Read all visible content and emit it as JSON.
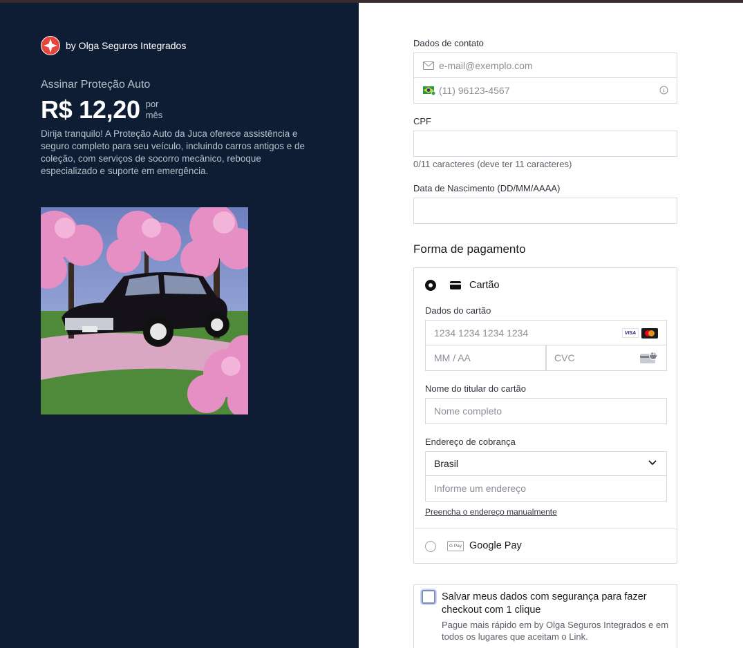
{
  "merchant": {
    "name": "by Olga Seguros Integrados"
  },
  "product": {
    "title": "Assinar Proteção Auto",
    "price": "R$ 12,20",
    "per_1": "por",
    "per_2": "mês",
    "description": "Dirija tranquilo! A Proteção Auto da Juca oferece assistência e seguro completo para seu veículo, incluindo carros antigos e de coleção, com serviços de socorro mecânico, reboque especializado e suporte em emergência."
  },
  "contact": {
    "label": "Dados de contato",
    "email_placeholder": "e-mail@exemplo.com",
    "phone_placeholder": "(11) 96123-4567"
  },
  "cpf": {
    "label": "CPF",
    "hint": "0/11 caracteres (deve ter 11 caracteres)"
  },
  "birth": {
    "label": "Data de Nascimento (DD/MM/AAAA)"
  },
  "payment": {
    "title": "Forma de pagamento",
    "card_option": "Cartão",
    "card_data_label": "Dados do cartão",
    "card_number_placeholder": "1234 1234 1234 1234",
    "expiry_placeholder": "MM / AA",
    "cvc_placeholder": "CVC",
    "cvc_badge": "135",
    "holder_label": "Nome do titular do cartão",
    "holder_placeholder": "Nome completo",
    "billing_label": "Endereço de cobrança",
    "country": "Brasil",
    "address_placeholder": "Informe um endereço",
    "manual_link": "Preencha o endereço manualmente",
    "gpay_option": "Google Pay",
    "gpay_badge": "G Pay",
    "visa": "VISA"
  },
  "save": {
    "title": "Salvar meus dados com segurança para fazer checkout com 1 clique",
    "subtitle": "Pague mais rápido em by Olga Seguros Integrados e em todos os lugares que aceitam o Link."
  }
}
